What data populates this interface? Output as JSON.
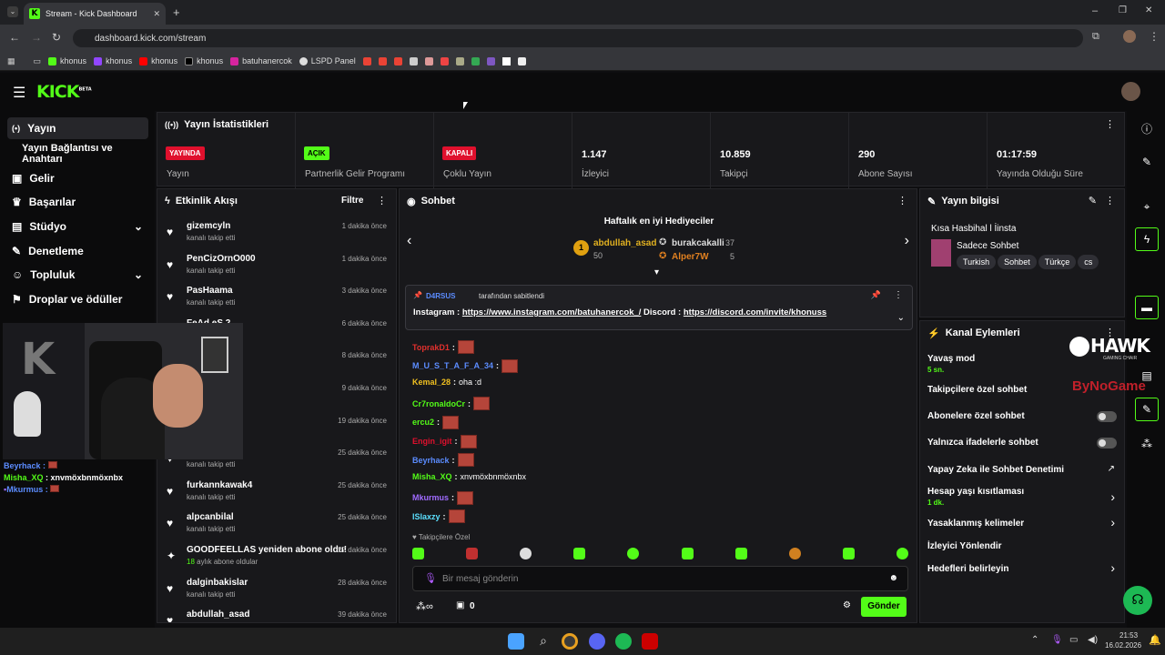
{
  "browser": {
    "tab_title": "Stream - Kick Dashboard",
    "url": "dashboard.kick.com/stream",
    "bookmarks": [
      "khonus",
      "khonus",
      "khonus",
      "khonus",
      "batuhanercok",
      "LSPD Panel"
    ]
  },
  "app": {
    "logo": "KICK",
    "beta": "BETA"
  },
  "sidebar": {
    "items": [
      {
        "label": "Yayın",
        "icon": "radio-icon"
      },
      {
        "label": "Yayın Bağlantısı ve Anahtarı"
      },
      {
        "label": "Gelir"
      },
      {
        "label": "Başarılar"
      },
      {
        "label": "Stüdyo"
      },
      {
        "label": "Denetleme"
      },
      {
        "label": "Topluluk"
      },
      {
        "label": "Droplar ve ödüller"
      }
    ]
  },
  "stats": {
    "title": "Yayın İstatistikleri",
    "items": [
      {
        "badge": "YAYINDA",
        "label": "Yayın",
        "color": "#e0102d"
      },
      {
        "badge": "AÇIK",
        "label": "Partnerlik Gelir Programı",
        "color": "#53fc18"
      },
      {
        "badge": "KAPALI",
        "label": "Çoklu Yayın",
        "color": "#e0102d"
      },
      {
        "value": "1.147",
        "label": "İzleyici"
      },
      {
        "value": "10.859",
        "label": "Takipçi"
      },
      {
        "value": "290",
        "label": "Abone Sayısı"
      },
      {
        "value": "01:17:59",
        "label": "Yayında Olduğu Süre"
      }
    ]
  },
  "activity": {
    "title": "Etkinlik Akışı",
    "filter": "Filtre",
    "events": [
      {
        "user": "gizemcyln",
        "sub": "kanalı takip etti",
        "time": "1 dakika önce"
      },
      {
        "user": "PenCizOrnO000",
        "sub": "kanalı takip etti",
        "time": "1 dakika önce"
      },
      {
        "user": "PasHaama",
        "sub": "kanalı takip etti",
        "time": "3 dakika önce"
      },
      {
        "user": "FeAd eS 2",
        "sub": "",
        "time": "6 dakika önce"
      },
      {
        "user": "",
        "sub": "",
        "time": "8 dakika önce"
      },
      {
        "user": "",
        "sub": "",
        "time": "9 dakika önce"
      },
      {
        "user": "",
        "sub": "",
        "time": "19 dakika önce"
      },
      {
        "user": "",
        "sub": "kanalı takip etti",
        "time": "25 dakika önce"
      },
      {
        "user": "furkannkawak4",
        "sub": "kanalı takip etti",
        "time": "25 dakika önce"
      },
      {
        "user": "alpcanbilal",
        "sub": "kanalı takip etti",
        "time": "25 dakika önce"
      },
      {
        "user": "GOODFEELLAS yeniden abone oldu!",
        "sub": "aylık abone oldular",
        "sub_num": "18",
        "time": "27 dakika önce"
      },
      {
        "user": "dalginbakislar",
        "sub": "kanalı takip etti",
        "time": "28 dakika önce"
      },
      {
        "user": "abdullah_asad",
        "sub": "",
        "time": "39 dakika önce"
      }
    ]
  },
  "chat": {
    "title": "Sohbet",
    "gifters_title": "Haftalık en iyi Hediyeciler",
    "gifters": [
      {
        "name": "abdullah_asad",
        "count": "50"
      },
      {
        "name": "burakcakalli",
        "count": "37"
      },
      {
        "name": "Alper7W",
        "count": "5"
      }
    ],
    "pinned_by": "D4RSUS",
    "pinned_suffix": "tarafından sabitlendi",
    "pinned_prefix": "Instagram : ",
    "pinned_link1": "https://www.instagram.com/batuhanercok_/",
    "pinned_mid": " Discord : ",
    "pinned_link2": "https://discord.com/invite/khonuss",
    "messages": [
      {
        "user": "ToprakD1",
        "color": "#e0302d",
        "text": ""
      },
      {
        "user": "M_U_S_T_A_F_A_34",
        "color": "#5b8cff",
        "text": ""
      },
      {
        "user": "Kemal_28",
        "color": "#f0c020",
        "text": "oha :d"
      },
      {
        "user": "Cr7ronaldoCr",
        "color": "#53fc18",
        "text": ""
      },
      {
        "user": "ercu2",
        "color": "#53fc18",
        "text": ""
      },
      {
        "user": "Engin_igit",
        "color": "#e0102d",
        "text": ""
      },
      {
        "user": "Beyrhack",
        "color": "#5b8cff",
        "text": ""
      },
      {
        "user": "Misha_XQ",
        "color": "#53fc18",
        "text": "xnvmöxbnmöxnbx"
      },
      {
        "user": "Mkurmus",
        "color": "#a06bff",
        "text": ""
      },
      {
        "user": "lSlaxzy",
        "color": "#5be0ff",
        "text": ""
      }
    ],
    "followers_only": "Takipçilere Özel",
    "input_placeholder": "Bir mesaj gönderin",
    "points": "0",
    "send": "Gönder"
  },
  "info": {
    "title": "Yayın bilgisi",
    "stream_title": "Kısa Hasbihal l İinsta",
    "category": "Sadece Sohbet",
    "tags": [
      "Turkish",
      "Sohbet",
      "Türkçe",
      "cs"
    ]
  },
  "actions": {
    "title": "Kanal Eylemleri",
    "items": [
      {
        "label": "Yavaş mod",
        "sub": "5 sn."
      },
      {
        "label": "Takipçilere özel sohbet"
      },
      {
        "label": "Abonelere özel sohbet"
      },
      {
        "label": "Yalnızca ifadelerle sohbet"
      },
      {
        "label": "Yapay Zeka ile Sohbet Denetimi"
      },
      {
        "label": "Hesap yaşı kısıtlaması",
        "sub": "1 dk."
      },
      {
        "label": "Yasaklanmış kelimeler"
      },
      {
        "label": "İzleyici Yönlendir"
      },
      {
        "label": "Hedefleri belirleyin"
      }
    ]
  },
  "overlay": {
    "lines": [
      {
        "user": "Beyrhack",
        "text": ""
      },
      {
        "user": "Misha_XQ",
        "text": "xnvmöxbnmöxnbx"
      },
      {
        "user": "Mkurmus",
        "text": ""
      }
    ],
    "hawk": "HAWK",
    "hawk_sub": "GAMING CHAIR",
    "sponsor": "ByNoGame"
  },
  "taskbar": {
    "time": "21:53",
    "date": "16.02.2026"
  }
}
